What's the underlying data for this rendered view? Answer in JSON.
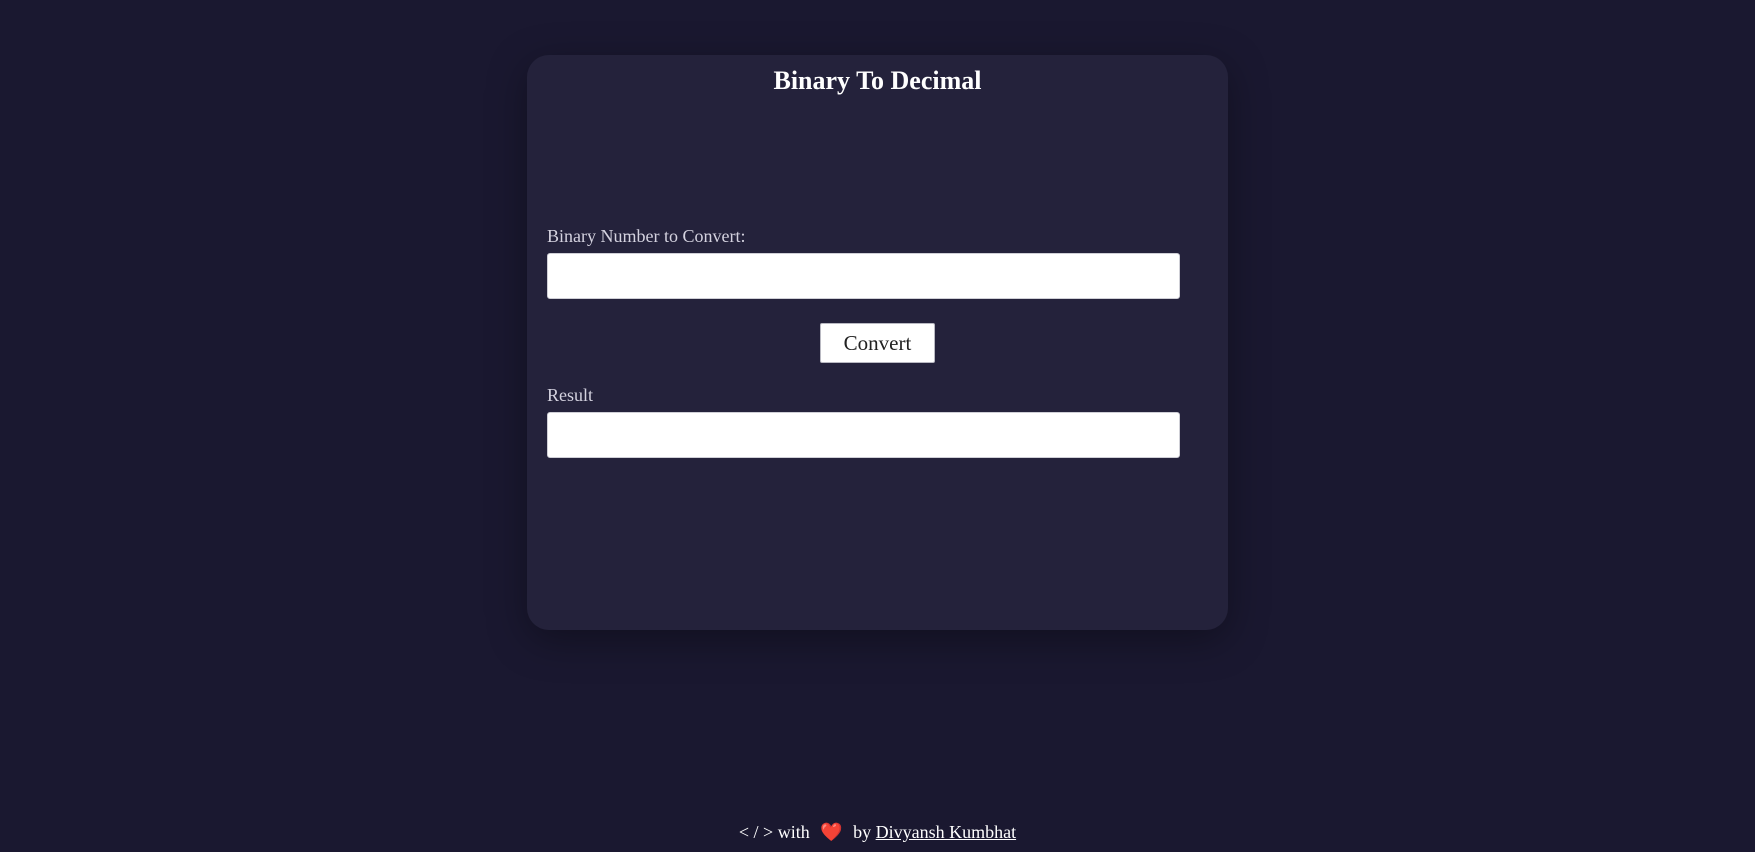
{
  "page": {
    "title": "Binary To Decimal"
  },
  "form": {
    "binary_label": "Binary Number to Convert:",
    "binary_value": "",
    "binary_placeholder": "",
    "convert_label": "Convert",
    "result_label": "Result",
    "result_value": "",
    "result_placeholder": ""
  },
  "footer": {
    "code_text": "< / > with",
    "heart_icon": "heart-icon",
    "by_text": "by",
    "author_name": "Divyansh Kumbhat"
  },
  "colors": {
    "background": "#1a1830",
    "card": "#24223b",
    "heart": "#e0283d"
  }
}
